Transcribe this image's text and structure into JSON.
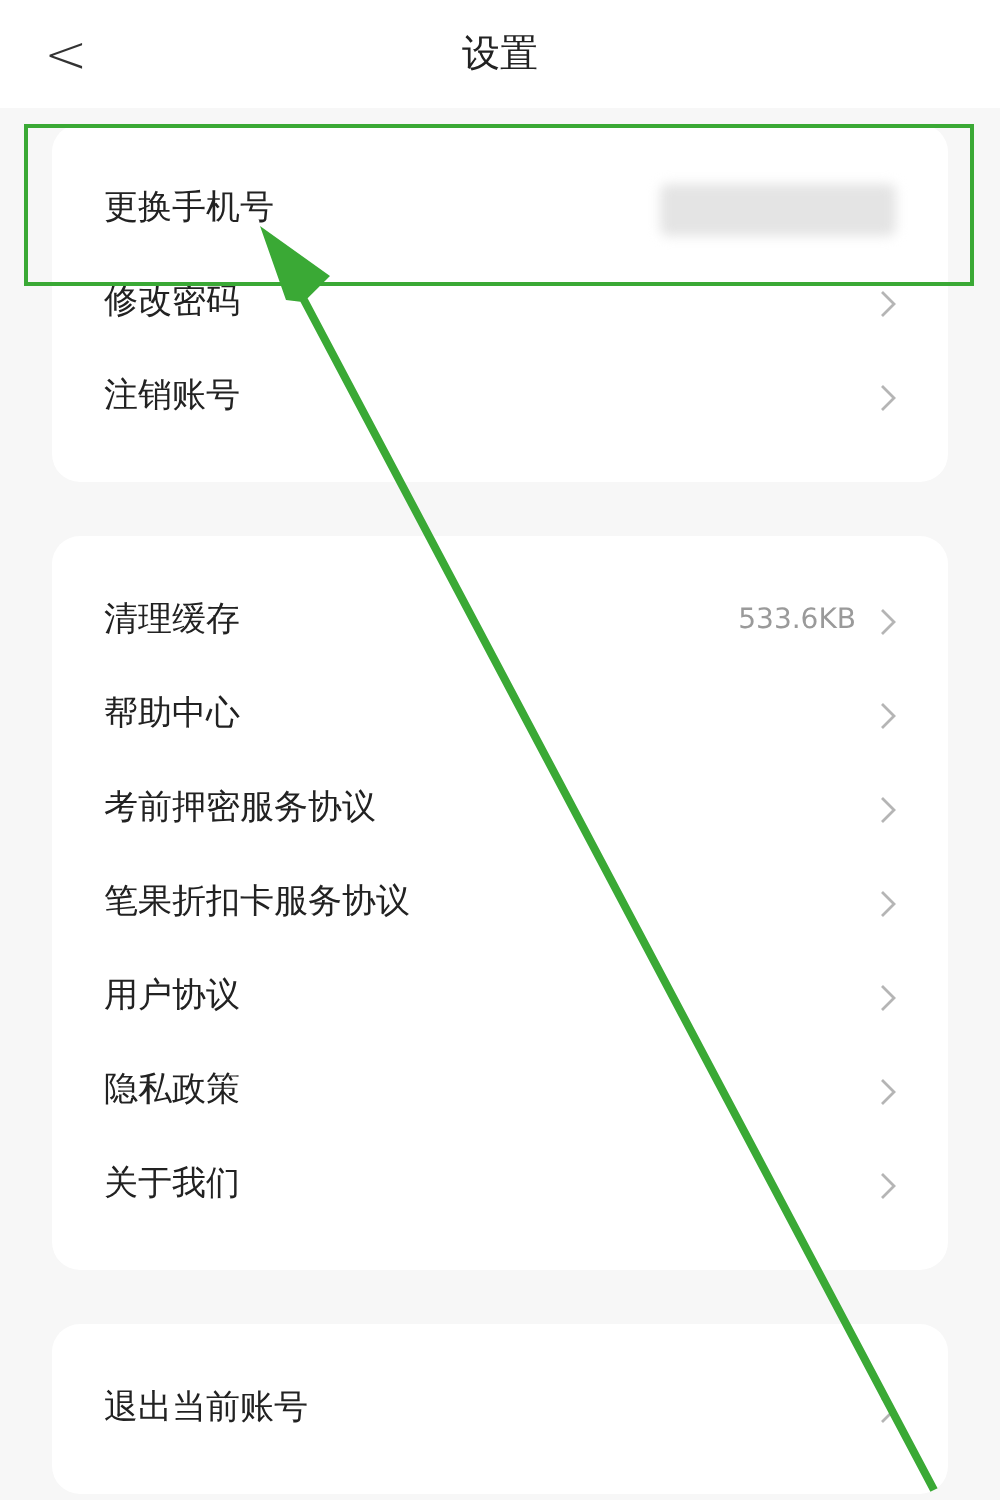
{
  "header": {
    "back": "<",
    "title": "设置"
  },
  "groups": [
    {
      "items": [
        {
          "label": "更换手机号",
          "kind": "redacted"
        },
        {
          "label": "修改密码",
          "kind": "link"
        },
        {
          "label": "注销账号",
          "kind": "link"
        }
      ]
    },
    {
      "items": [
        {
          "label": "清理缓存",
          "kind": "link",
          "value": "533.6KB"
        },
        {
          "label": "帮助中心",
          "kind": "link"
        },
        {
          "label": "考前押密服务协议",
          "kind": "link"
        },
        {
          "label": "笔果折扣卡服务协议",
          "kind": "link"
        },
        {
          "label": "用户协议",
          "kind": "link"
        },
        {
          "label": "隐私政策",
          "kind": "link"
        },
        {
          "label": "关于我们",
          "kind": "link"
        }
      ]
    },
    {
      "items": [
        {
          "label": "退出当前账号",
          "kind": "link"
        }
      ]
    }
  ],
  "annotation": {
    "highlight": true,
    "arrow": true
  }
}
